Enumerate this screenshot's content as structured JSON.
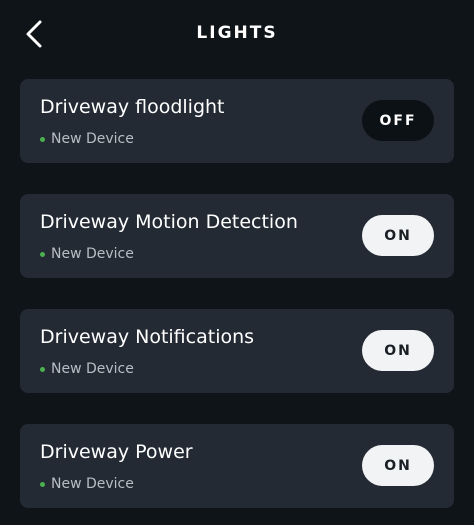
{
  "header": {
    "title": "LIGHTS",
    "back_icon": "chevron-left-icon"
  },
  "devices": [
    {
      "name": "Driveway floodlight",
      "status": "New Device",
      "toggle_label": "OFF",
      "state": "off"
    },
    {
      "name": "Driveway Motion Detection",
      "status": "New Device",
      "toggle_label": "ON",
      "state": "on"
    },
    {
      "name": "Driveway Notifications",
      "status": "New Device",
      "toggle_label": "ON",
      "state": "on"
    },
    {
      "name": "Driveway Power",
      "status": "New Device",
      "toggle_label": "ON",
      "state": "on"
    }
  ],
  "colors": {
    "background": "#0f1419",
    "card": "#232a33",
    "status_dot": "#4caf50",
    "toggle_on": "#f2f3f4",
    "toggle_off": "#0c1116"
  }
}
